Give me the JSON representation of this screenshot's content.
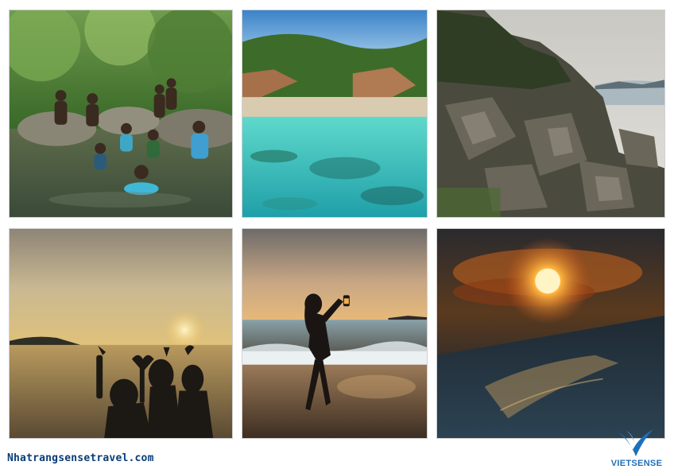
{
  "footer": {
    "website": "Nhatrangsensetravel.com",
    "brand_logo": "VIETSENSE"
  },
  "colors": {
    "url_text": "#0a3d78",
    "brand_blue": "#1f6fb8"
  }
}
